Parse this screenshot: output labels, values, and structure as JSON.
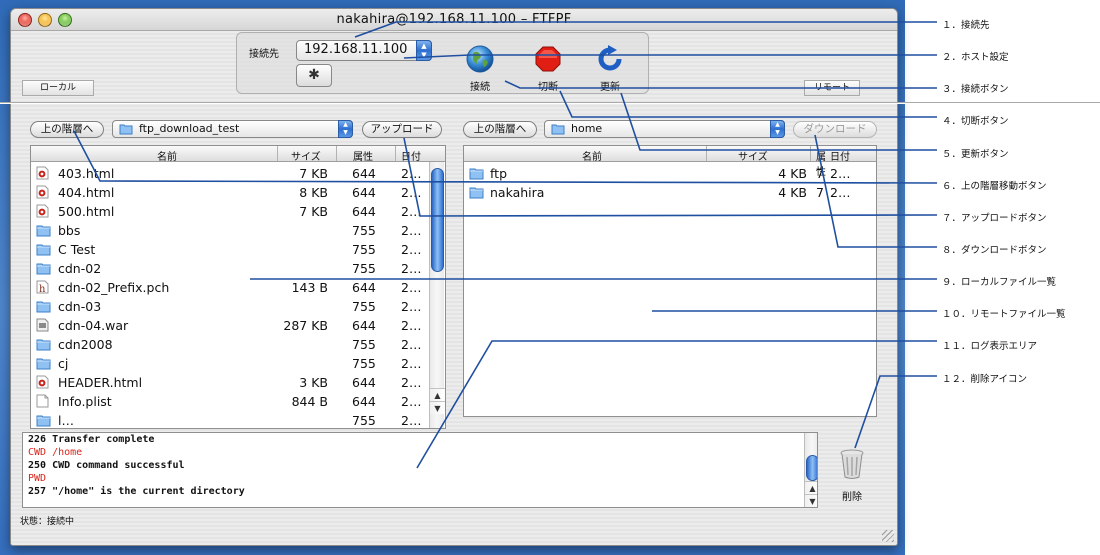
{
  "window": {
    "title": "nakahira@192.168.11.100  –  FTFPF"
  },
  "toolbar": {
    "host_label": "接続先",
    "host_value": "192.168.11.100",
    "connect_label": "接続",
    "disconnect_label": "切断",
    "refresh_label": "更新"
  },
  "tags": {
    "local": "ローカル",
    "remote": "リモート"
  },
  "local": {
    "up_button": "上の階層へ",
    "path": "ftp_download_test",
    "upload_button": "アップロード",
    "columns": [
      "名前",
      "サイズ",
      "属性",
      "日付"
    ],
    "files": [
      {
        "icon": "html",
        "name": "403.html",
        "size": "7 KB",
        "perm": "644",
        "date": "2…"
      },
      {
        "icon": "html",
        "name": "404.html",
        "size": "8 KB",
        "perm": "644",
        "date": "2…"
      },
      {
        "icon": "html",
        "name": "500.html",
        "size": "7 KB",
        "perm": "644",
        "date": "2…"
      },
      {
        "icon": "folder",
        "name": "bbs",
        "size": "",
        "perm": "755",
        "date": "2…"
      },
      {
        "icon": "folder",
        "name": "C Test",
        "size": "",
        "perm": "755",
        "date": "2…"
      },
      {
        "icon": "folder",
        "name": "cdn-02",
        "size": "",
        "perm": "755",
        "date": "2…"
      },
      {
        "icon": "header",
        "name": "cdn-02_Prefix.pch",
        "size": "143 B",
        "perm": "644",
        "date": "2…"
      },
      {
        "icon": "folder",
        "name": "cdn-03",
        "size": "",
        "perm": "755",
        "date": "2…"
      },
      {
        "icon": "war",
        "name": "cdn-04.war",
        "size": "287 KB",
        "perm": "644",
        "date": "2…"
      },
      {
        "icon": "folder",
        "name": "cdn2008",
        "size": "",
        "perm": "755",
        "date": "2…"
      },
      {
        "icon": "folder",
        "name": "cj",
        "size": "",
        "perm": "755",
        "date": "2…"
      },
      {
        "icon": "html",
        "name": "HEADER.html",
        "size": "3 KB",
        "perm": "644",
        "date": "2…"
      },
      {
        "icon": "doc",
        "name": "Info.plist",
        "size": "844 B",
        "perm": "644",
        "date": "2…"
      },
      {
        "icon": "folder",
        "name": "l…",
        "size": "",
        "perm": "755",
        "date": "2…"
      }
    ]
  },
  "remote": {
    "up_button": "上の階層へ",
    "path": "home",
    "download_button": "ダウンロード",
    "columns": [
      "名前",
      "サイズ",
      "属性",
      "日付"
    ],
    "files": [
      {
        "icon": "folder",
        "name": "ftp",
        "size": "4 KB",
        "perm": "7",
        "date": "2…"
      },
      {
        "icon": "folder",
        "name": "nakahira",
        "size": "4 KB",
        "perm": "7",
        "date": "2…"
      }
    ]
  },
  "log": {
    "lines": [
      {
        "text": "226 Transfer complete",
        "kind": "response"
      },
      {
        "text": "CWD /home",
        "kind": "command"
      },
      {
        "text": "250 CWD command successful",
        "kind": "response"
      },
      {
        "text": "PWD",
        "kind": "command"
      },
      {
        "text": "257 \"/home\" is the current directory",
        "kind": "response"
      }
    ]
  },
  "trash_label": "削除",
  "status": "状態：接続中",
  "annotations": [
    "１．接続先",
    "２．ホスト設定",
    "３．接続ボタン",
    "４．切断ボタン",
    "５．更新ボタン",
    "６．上の階層移動ボタン",
    "７．アップロードボタン",
    "８．ダウンロードボタン",
    "９．ローカルファイル一覧",
    "１０．リモートファイル一覧",
    "１１．ログ表示エリア",
    "１２．削除アイコン"
  ],
  "colors": {
    "annotation_line": "#1f4fa0",
    "log_command": "#d8251b",
    "log_response": "#111111"
  }
}
